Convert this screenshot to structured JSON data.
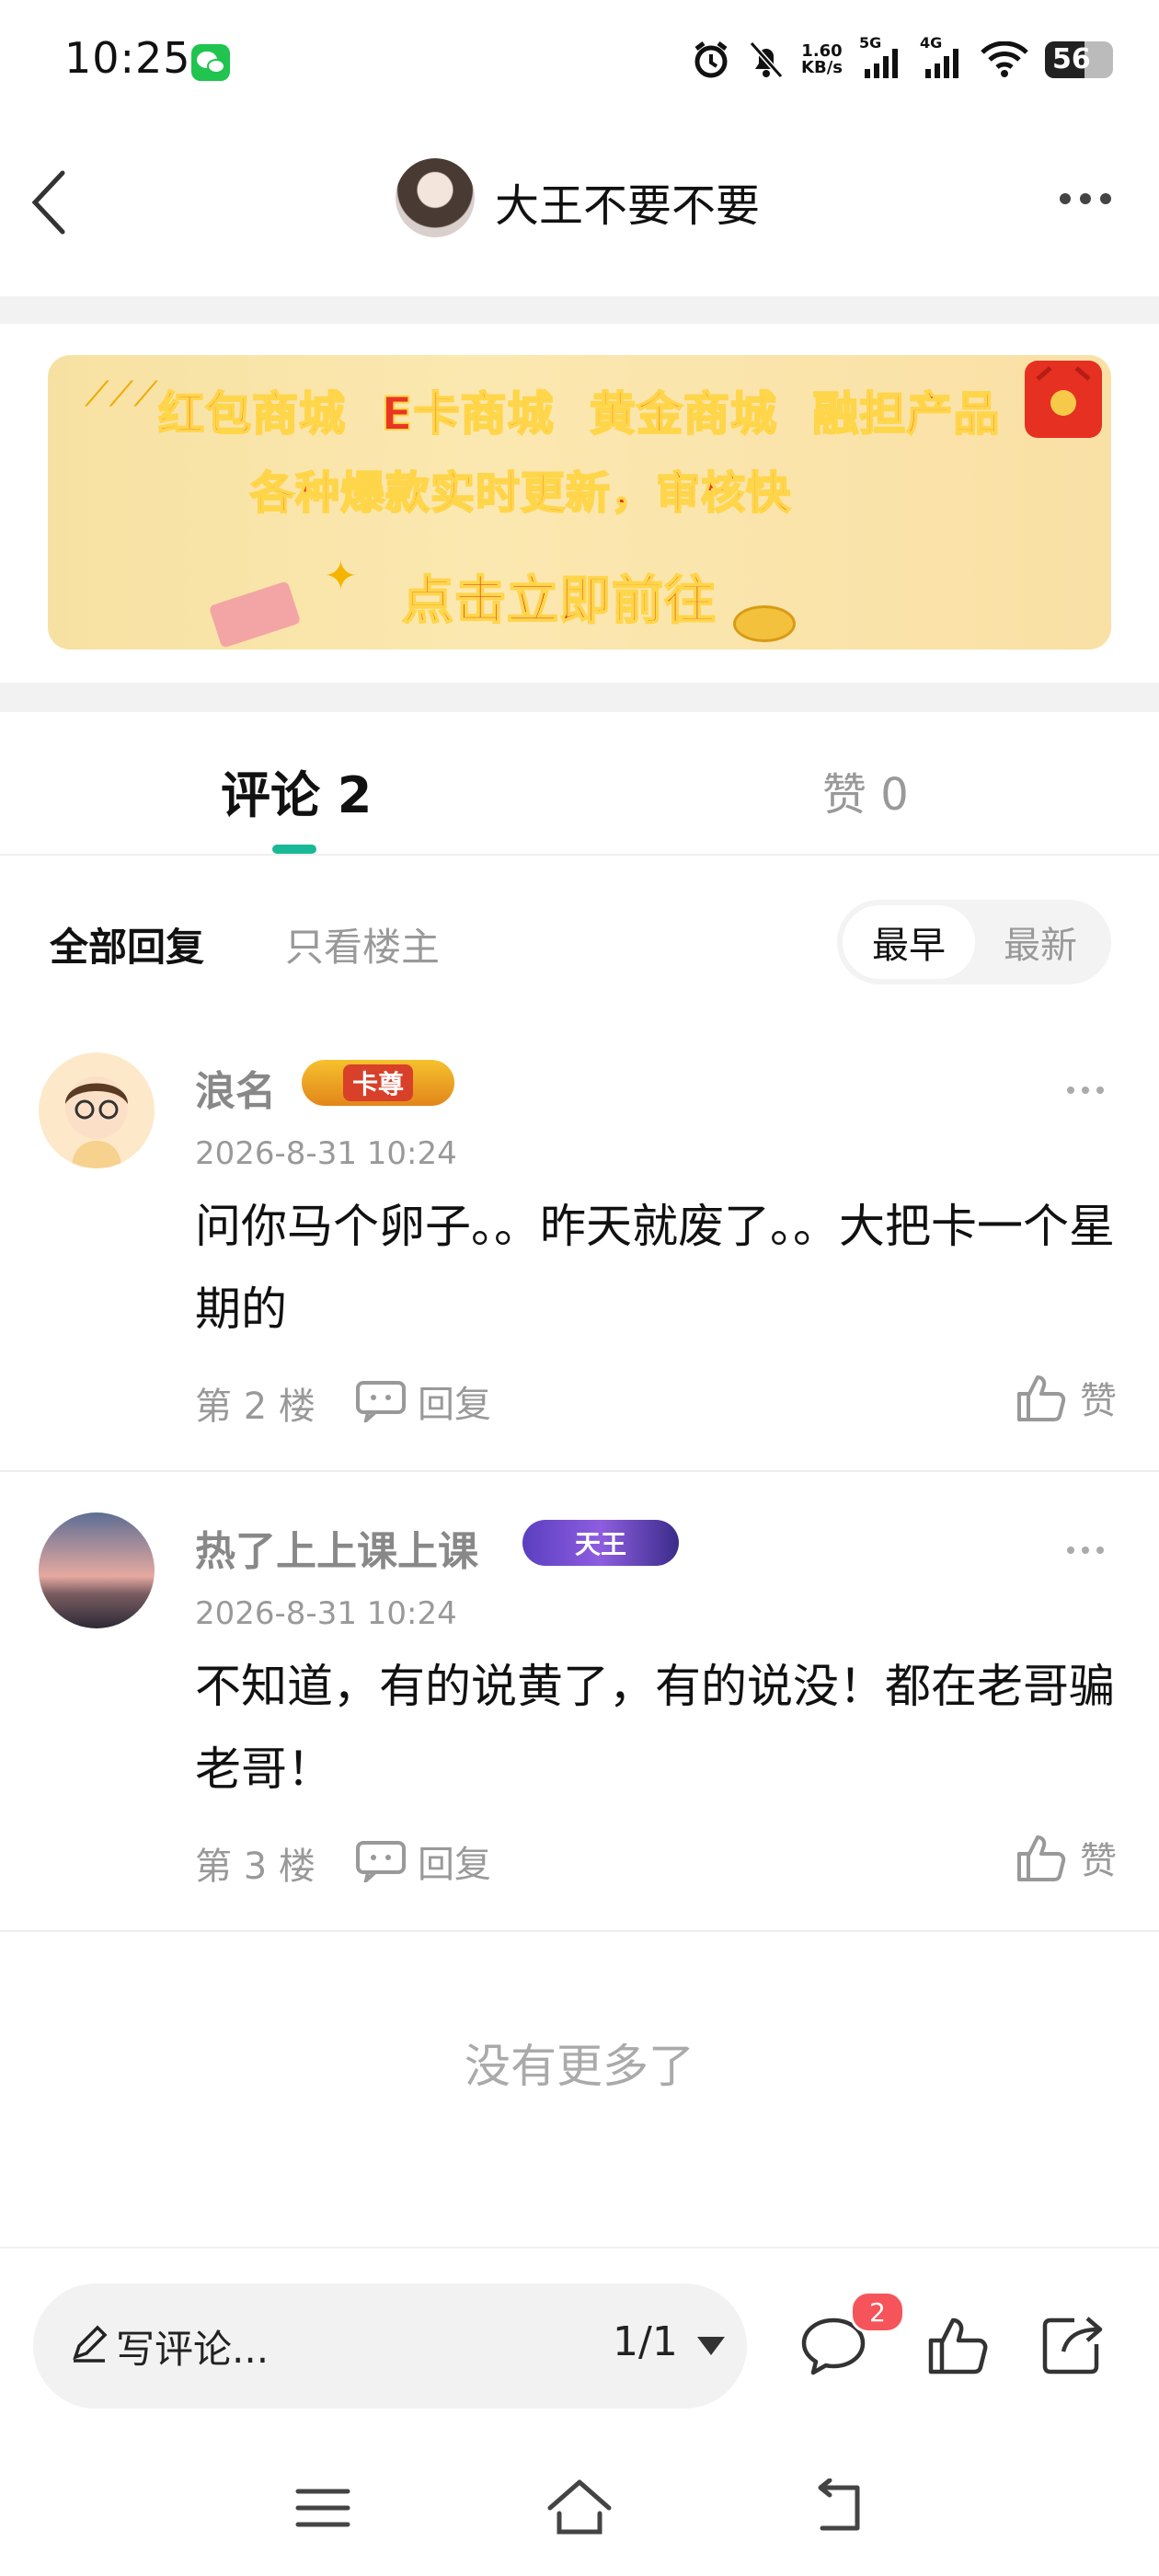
{
  "status_bar": {
    "time": "10:25",
    "net_speed_value": "1.60",
    "net_speed_unit": "KB/s",
    "signal1_label": "5G",
    "signal2_label": "4G",
    "battery": "56",
    "icons": [
      "wechat-icon",
      "alarm-icon",
      "mute-bell-icon",
      "signal-icon",
      "wifi-icon",
      "battery-icon"
    ]
  },
  "header": {
    "author_name": "大王不要不要"
  },
  "banner": {
    "line1": "红包商城  E卡商城  黄金商城  融担产品",
    "line2": "各种爆款实时更新，审核快",
    "line3": "点击立即前往"
  },
  "tabs": {
    "comments_label": "评论 2",
    "likes_label": "赞 0"
  },
  "filters": {
    "all": "全部回复",
    "op_only": "只看楼主",
    "sort_earliest": "最早",
    "sort_latest": "最新",
    "selected_sort": "最早"
  },
  "comments": [
    {
      "name": "浪名",
      "badge": "卡尊",
      "time": "2026-8-31 10:24",
      "text": "问你马个卵子。。昨天就废了。。大把卡一个星期的",
      "floor": "第 2 楼",
      "reply_label": "回复",
      "like_label": "赞"
    },
    {
      "name": "热了上上课上课",
      "badge": "天王",
      "time": "2026-8-31 10:24",
      "text": "不知道，有的说黄了，有的说没！都在老哥骗老哥！",
      "floor": "第 3 楼",
      "reply_label": "回复",
      "like_label": "赞"
    }
  ],
  "no_more": "没有更多了",
  "bottom_bar": {
    "write_placeholder": "写评论...",
    "page_indicator": "1/1",
    "comment_count": "2"
  },
  "colors": {
    "accent": "#19b997",
    "badge_red": "#f5555a",
    "banner_bg": "#fbe8b0",
    "banner_text": "#e83524"
  }
}
